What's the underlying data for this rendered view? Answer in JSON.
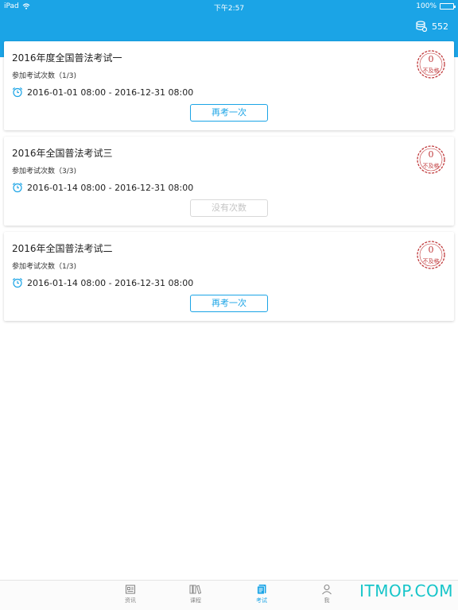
{
  "status_bar": {
    "carrier": "iPad",
    "time": "下午2:57",
    "battery": "100%"
  },
  "header": {
    "coins": "552"
  },
  "exams": [
    {
      "title": "2016年度全国普法考试一",
      "attempts": "参加考试次数（1/3)",
      "time_range": "2016-01-01 08:00 - 2016-12-31 08:00",
      "button_label": "再考一次",
      "button_enabled": true,
      "score": "0",
      "result": "不及格"
    },
    {
      "title": "2016年全国普法考试三",
      "attempts": "参加考试次数（3/3)",
      "time_range": "2016-01-14 08:00 - 2016-12-31 08:00",
      "button_label": "没有次数",
      "button_enabled": false,
      "score": "0",
      "result": "不及格"
    },
    {
      "title": "2016年全国普法考试二",
      "attempts": "参加考试次数（1/3)",
      "time_range": "2016-01-14 08:00 - 2016-12-31 08:00",
      "button_label": "再考一次",
      "button_enabled": true,
      "score": "0",
      "result": "不及格"
    }
  ],
  "tabbar": {
    "tabs": [
      {
        "label": "资讯",
        "icon": "news-icon",
        "active": false
      },
      {
        "label": "课程",
        "icon": "books-icon",
        "active": false
      },
      {
        "label": "考试",
        "icon": "exam-icon",
        "active": true
      },
      {
        "label": "我",
        "icon": "person-icon",
        "active": false
      }
    ]
  },
  "watermark": "ITMOP.COM",
  "colors": {
    "accent": "#1ba4e6",
    "stamp": "#c0393b",
    "disabled": "#c4c4c4"
  }
}
